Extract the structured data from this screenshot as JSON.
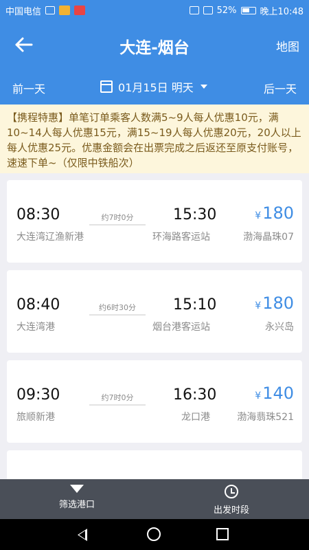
{
  "status_bar": {
    "carrier": "中国电信",
    "battery": "52%",
    "time": "晚上10:48"
  },
  "header": {
    "back_icon": "arrow-left-icon",
    "title": "大连-烟台",
    "map": "地图"
  },
  "date_bar": {
    "prev": "前一天",
    "date": "01月15日 明天",
    "next": "后一天"
  },
  "promo": {
    "text": "【携程特惠】单笔订单乘客人数满5~9人每人优惠10元，满10~14人每人优惠15元，满15~19人每人优惠20元，20人以上每人优惠25元。优惠金额会在出票完成之后返还至原支付账号，速速下单~（仅限中铁船次）"
  },
  "voyages": [
    {
      "dep_time": "08:30",
      "dep_port": "大连湾辽渔新港",
      "duration": "约7时0分",
      "arr_time": "15:30",
      "arr_port": "环海路客运站",
      "currency": "¥",
      "price": "180",
      "ship": "渤海晶珠07"
    },
    {
      "dep_time": "08:40",
      "dep_port": "大连湾港",
      "duration": "约6时30分",
      "arr_time": "15:10",
      "arr_port": "烟台港客运站",
      "currency": "¥",
      "price": "180",
      "ship": "永兴岛"
    },
    {
      "dep_time": "09:30",
      "dep_port": "旅顺新港",
      "duration": "约7时0分",
      "arr_time": "16:30",
      "arr_port": "龙口港",
      "currency": "¥",
      "price": "140",
      "ship": "渤海翡珠521"
    }
  ],
  "bottom_bar": {
    "filter": "筛选港口",
    "time": "出发时段"
  },
  "colors": {
    "brand_blue": "#3f8de4",
    "promo_bg": "#fdf6dc",
    "bottom_bar": "#4a4f58"
  }
}
